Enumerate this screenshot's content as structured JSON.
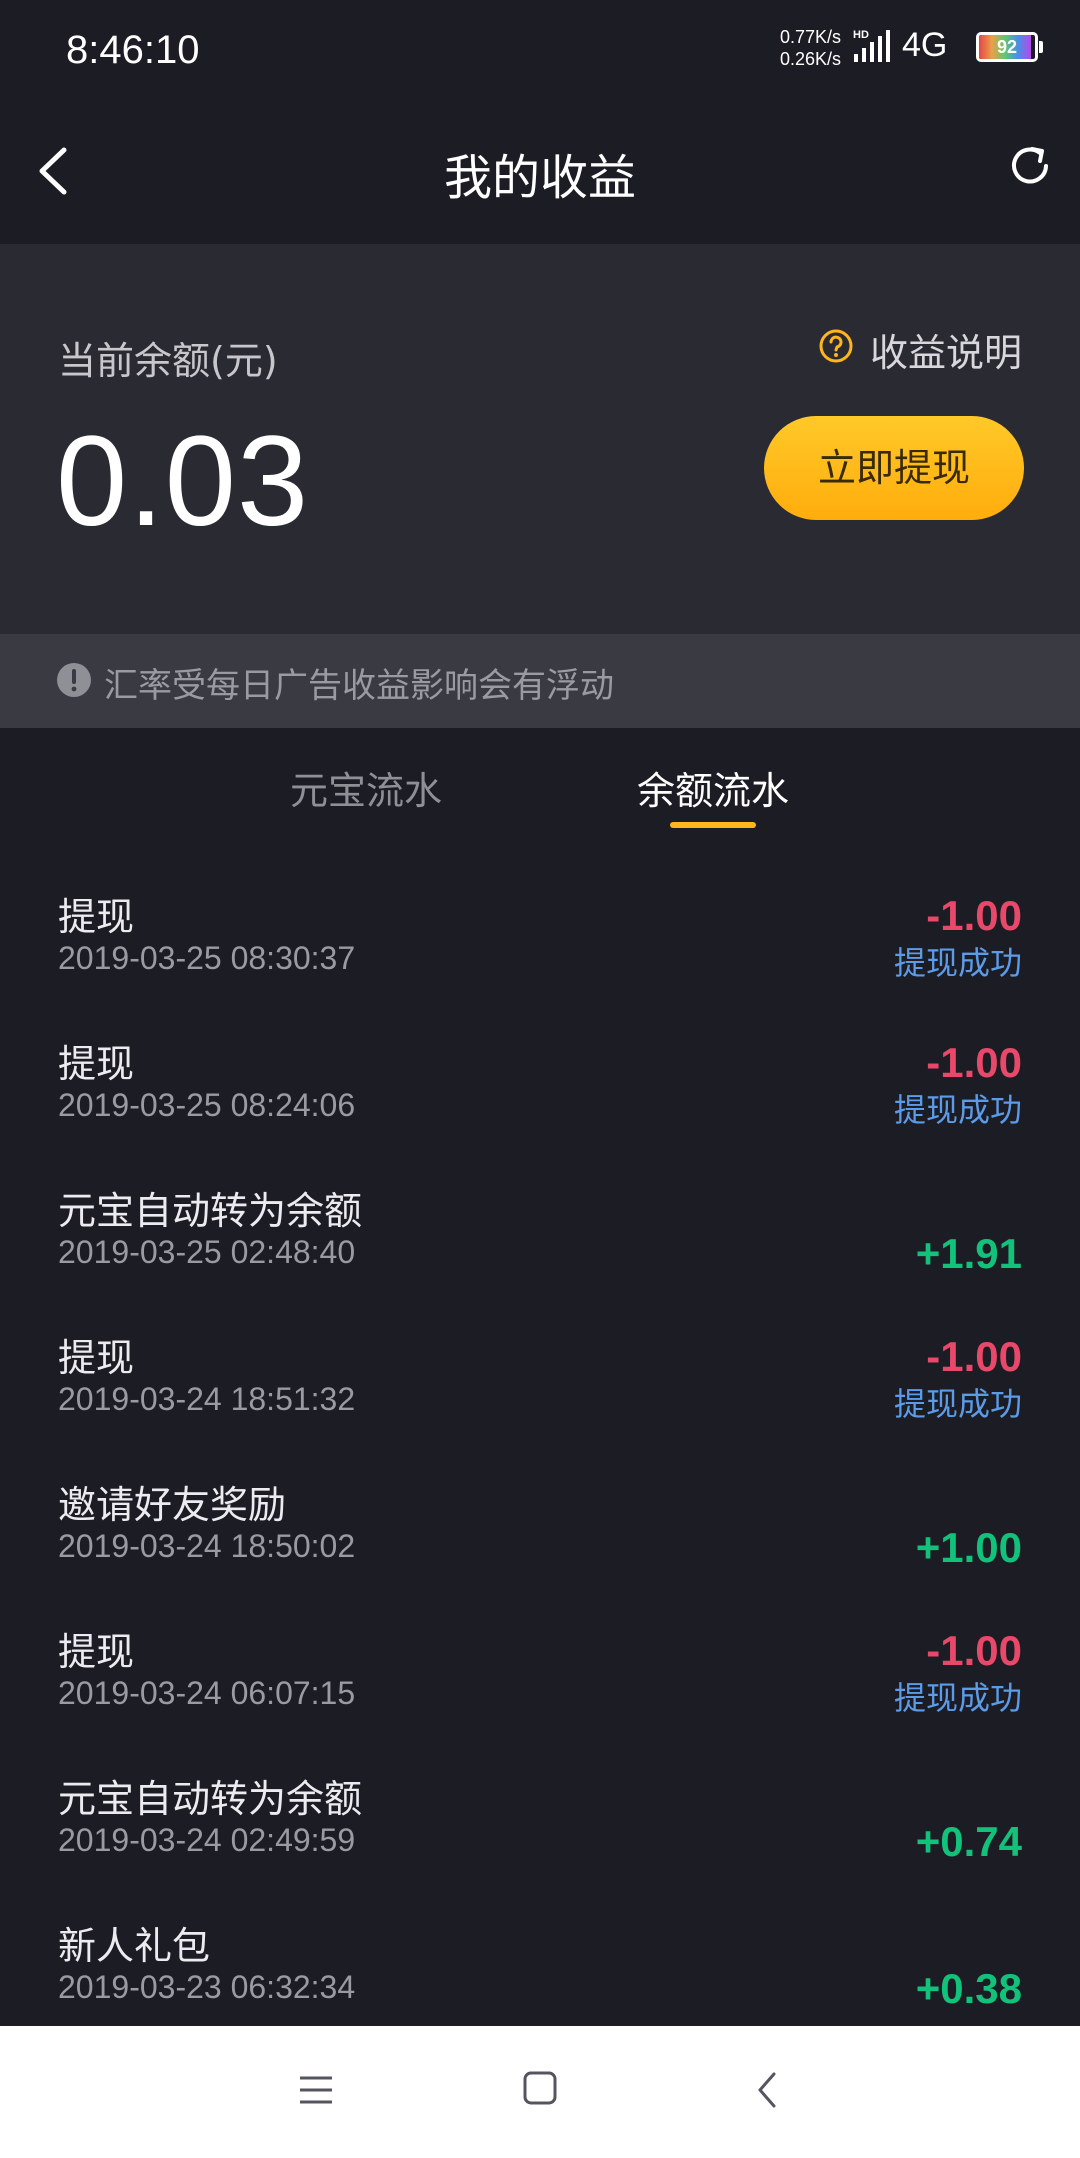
{
  "status_bar": {
    "time": "8:46:10",
    "net_up": "0.77K/s",
    "net_down": "0.26K/s",
    "signal_label": "HD",
    "network": "4G",
    "battery": "92"
  },
  "header": {
    "title": "我的收益",
    "back_icon": "chevron-left-icon",
    "refresh_icon": "refresh-icon"
  },
  "balance": {
    "label": "当前余额(元)",
    "value": "0.03",
    "info_label": "收益说明",
    "withdraw_label": "立即提现"
  },
  "notice": {
    "text": "汇率受每日广告收益影响会有浮动"
  },
  "tabs": [
    {
      "label": "元宝流水",
      "active": false
    },
    {
      "label": "余额流水",
      "active": true
    }
  ],
  "colors": {
    "negative": "#e8486a",
    "positive": "#12c27a",
    "status": "#5b9be8",
    "accent": "#ffb51c"
  },
  "transactions": [
    {
      "title": "提现",
      "time": "2019-03-25 08:30:37",
      "amount": "-1.00",
      "status": "提现成功"
    },
    {
      "title": "提现",
      "time": "2019-03-25 08:24:06",
      "amount": "-1.00",
      "status": "提现成功"
    },
    {
      "title": "元宝自动转为余额",
      "time": "2019-03-25 02:48:40",
      "amount": "+1.91",
      "status": ""
    },
    {
      "title": "提现",
      "time": "2019-03-24 18:51:32",
      "amount": "-1.00",
      "status": "提现成功"
    },
    {
      "title": "邀请好友奖励",
      "time": "2019-03-24 18:50:02",
      "amount": "+1.00",
      "status": ""
    },
    {
      "title": "提现",
      "time": "2019-03-24 06:07:15",
      "amount": "-1.00",
      "status": "提现成功"
    },
    {
      "title": "元宝自动转为余额",
      "time": "2019-03-24 02:49:59",
      "amount": "+0.74",
      "status": ""
    },
    {
      "title": "新人礼包",
      "time": "2019-03-23 06:32:34",
      "amount": "+0.38",
      "status": ""
    }
  ]
}
